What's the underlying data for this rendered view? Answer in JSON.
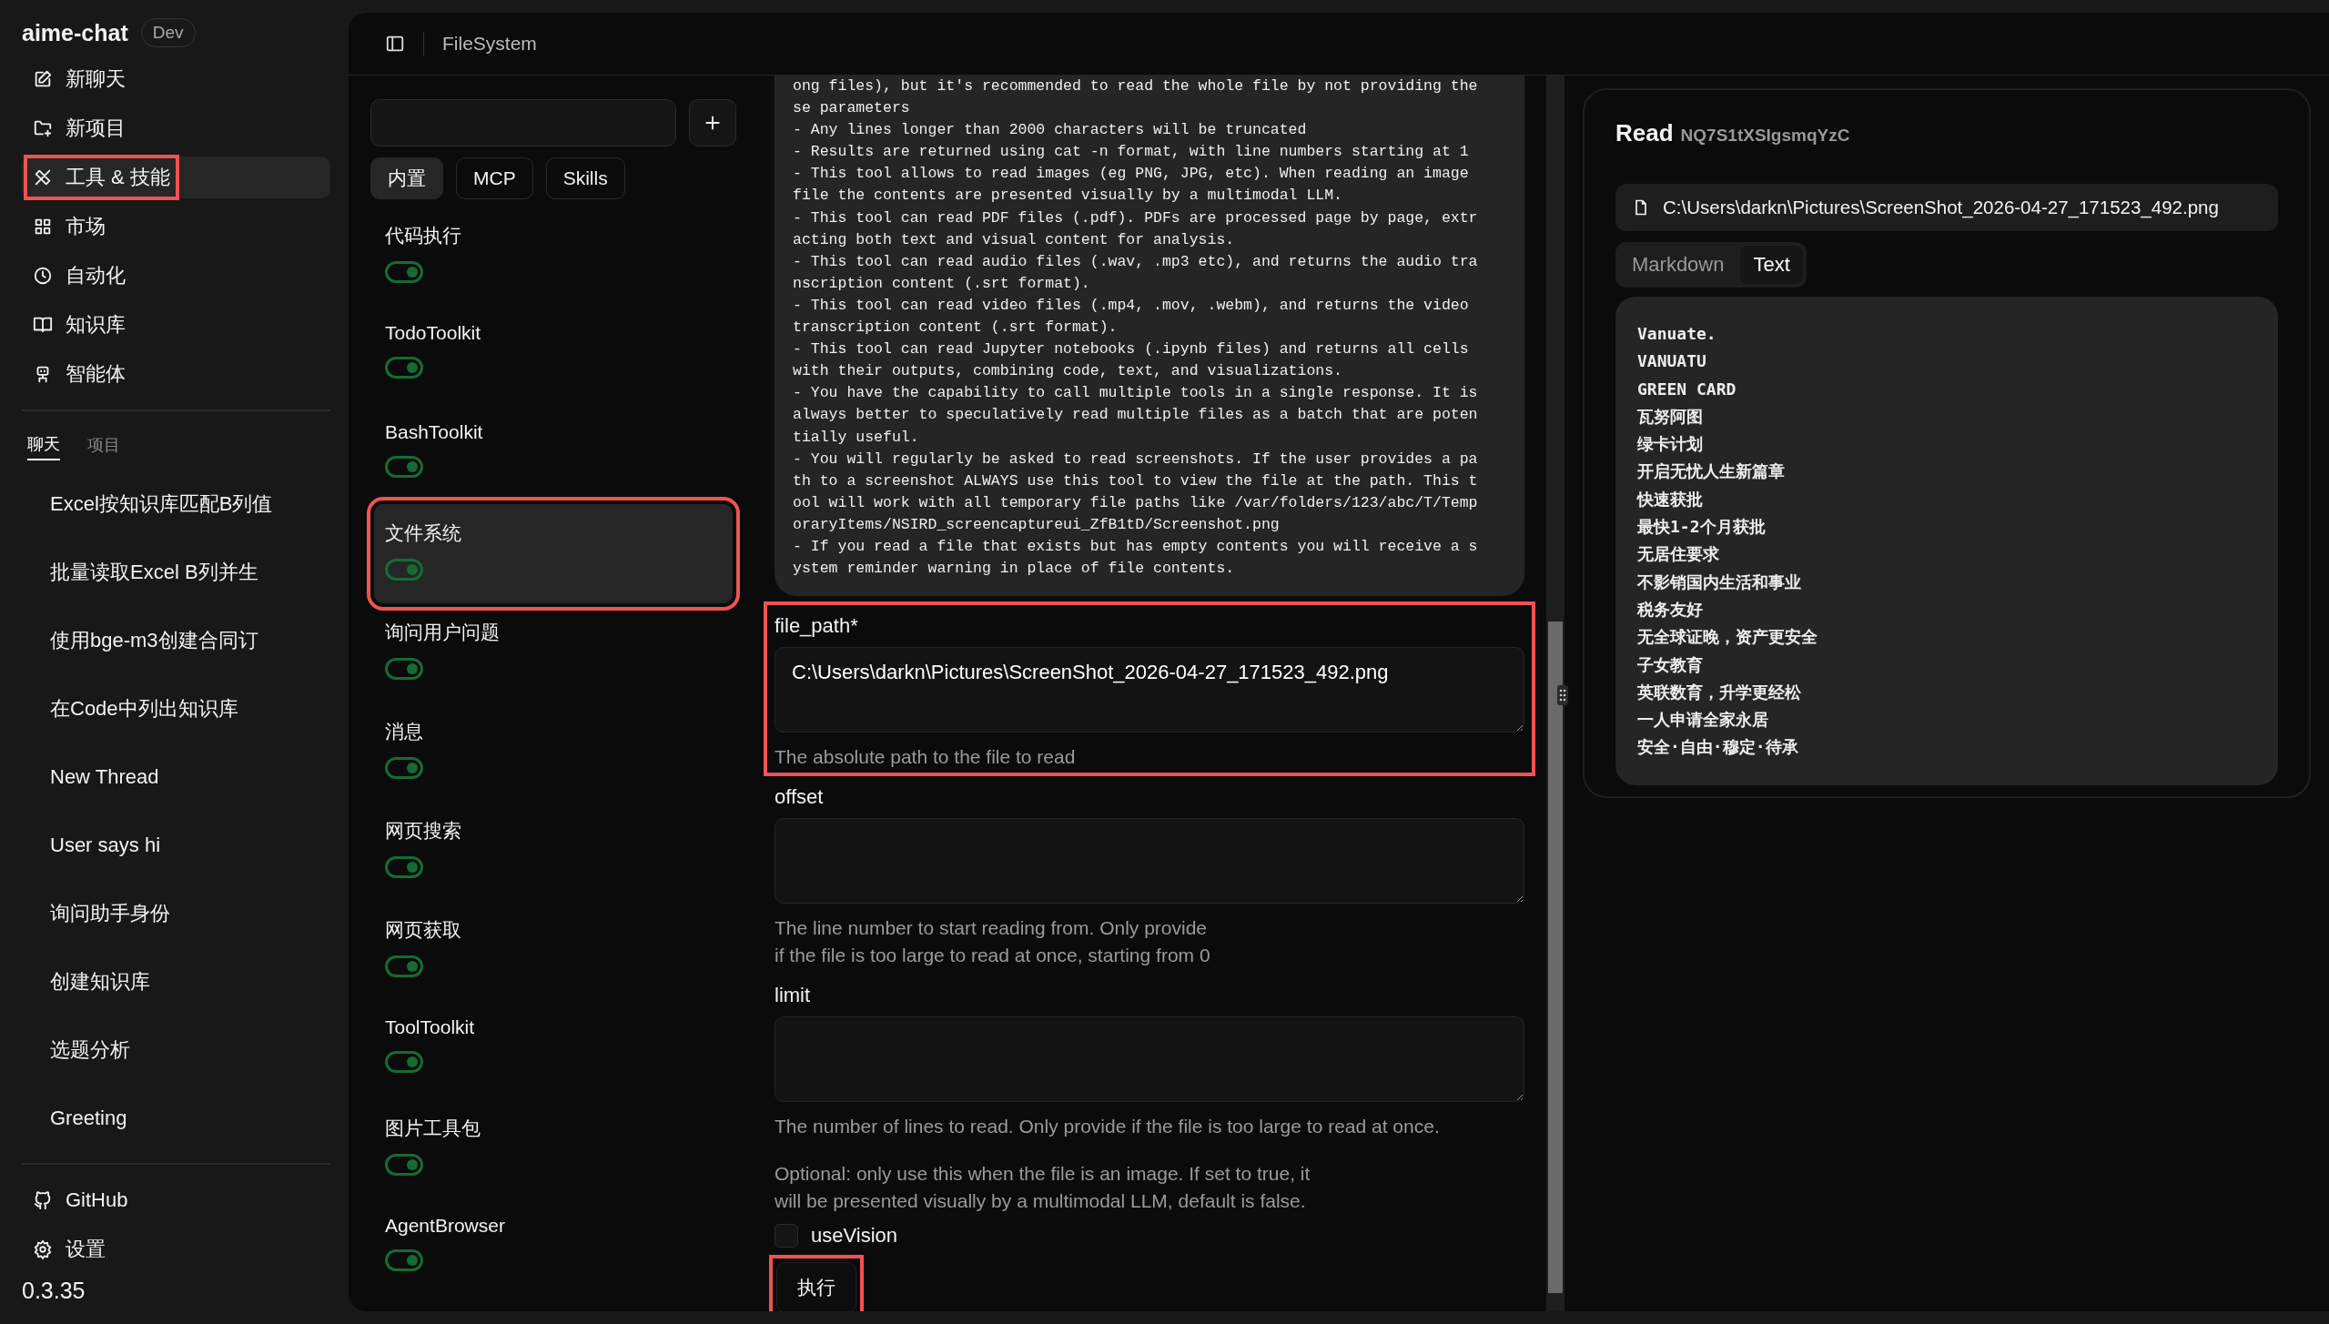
{
  "app": {
    "name": "aime-chat",
    "badge": "Dev",
    "version": "0.3.35"
  },
  "nav": [
    {
      "label": "新聊天",
      "kind": "edit",
      "selected": false,
      "highlighted": false
    },
    {
      "label": "新项目",
      "kind": "folder-plus",
      "selected": false,
      "highlighted": false
    },
    {
      "label": "工具 & 技能",
      "kind": "tools",
      "selected": true,
      "highlighted": true
    },
    {
      "label": "市场",
      "kind": "grid",
      "selected": false,
      "highlighted": false
    },
    {
      "label": "自动化",
      "kind": "clock",
      "selected": false,
      "highlighted": false
    },
    {
      "label": "知识库",
      "kind": "book",
      "selected": false,
      "highlighted": false
    },
    {
      "label": "智能体",
      "kind": "robot",
      "selected": false,
      "highlighted": false
    }
  ],
  "history_tabs": [
    {
      "label": "聊天",
      "selected": true
    },
    {
      "label": "项目",
      "selected": false
    }
  ],
  "chats": [
    "Excel按知识库匹配B列值",
    "批量读取Excel B列并生",
    "使用bge-m3创建合同订",
    "在Code中列出知识库",
    "New Thread",
    "User says hi",
    "询问助手身份",
    "创建知识库",
    "选题分析",
    "Greeting"
  ],
  "footer_links": [
    {
      "label": "GitHub",
      "kind": "github"
    },
    {
      "label": "设置",
      "kind": "settings"
    }
  ],
  "header": {
    "title": "FileSystem"
  },
  "tool_tabs": [
    {
      "label": "内置",
      "selected": true
    },
    {
      "label": "MCP",
      "selected": false
    },
    {
      "label": "Skills",
      "selected": false
    }
  ],
  "tools": [
    {
      "name": "代码执行",
      "on": true,
      "selected": false,
      "highlighted": false
    },
    {
      "name": "TodoToolkit",
      "on": true,
      "selected": false,
      "highlighted": false
    },
    {
      "name": "BashToolkit",
      "on": true,
      "selected": false,
      "highlighted": false
    },
    {
      "name": "文件系统",
      "on": true,
      "selected": true,
      "highlighted": true
    },
    {
      "name": "询问用户问题",
      "on": true,
      "selected": false,
      "highlighted": false
    },
    {
      "name": "消息",
      "on": true,
      "selected": false,
      "highlighted": false
    },
    {
      "name": "网页搜索",
      "on": true,
      "selected": false,
      "highlighted": false
    },
    {
      "name": "网页获取",
      "on": true,
      "selected": false,
      "highlighted": false
    },
    {
      "name": "ToolToolkit",
      "on": true,
      "selected": false,
      "highlighted": false
    },
    {
      "name": "图片工具包",
      "on": true,
      "selected": false,
      "highlighted": false
    },
    {
      "name": "AgentBrowser",
      "on": true,
      "selected": false,
      "highlighted": false
    }
  ],
  "description_lines": [
    "ong files), but it's recommended to read the whole file by not providing the",
    "se parameters",
    "- Any lines longer than 2000 characters will be truncated",
    "- Results are returned using cat -n format, with line numbers starting at 1",
    "- This tool allows to read images (eg PNG, JPG, etc). When reading an image",
    "file the contents are presented visually by a multimodal LLM.",
    "- This tool can read PDF files (.pdf). PDFs are processed page by page, extr",
    "acting both text and visual content for analysis.",
    "- This tool can read audio files (.wav, .mp3 etc), and returns the audio tra",
    "nscription content (.srt format).",
    "- This tool can read video files (.mp4, .mov, .webm), and returns the video",
    "transcription content (.srt format).",
    "- This tool can read Jupyter notebooks (.ipynb files) and returns all cells",
    "with their outputs, combining code, text, and visualizations.",
    "- You have the capability to call multiple tools in a single response. It is",
    "always better to speculatively read multiple files as a batch that are poten",
    "tially useful.",
    "- You will regularly be asked to read screenshots. If the user provides a pa",
    "th to a screenshot ALWAYS use this tool to view the file at the path. This t",
    "ool will work with all temporary file paths like /var/folders/123/abc/T/Temp",
    "oraryItems/NSIRD_screencaptureui_ZfB1tD/Screenshot.png",
    "- If you read a file that exists but has empty contents you will receive a s",
    "ystem reminder warning in place of file contents."
  ],
  "form": [
    {
      "kind": "textarea",
      "label": "file_path*",
      "value": "C:\\Users\\darkn\\Pictures\\ScreenShot_2026-04-27_171523_492.png",
      "hint_lines": [
        "The absolute path to the file to read"
      ],
      "highlighted": true
    },
    {
      "kind": "textarea",
      "label": "offset",
      "hint_lines": [
        "The line number to start reading from. Only provide",
        "if the file is too large to read at once, starting from 0"
      ],
      "highlighted": false
    },
    {
      "kind": "textarea",
      "label": "limit",
      "hint_lines": [
        "The number of lines to read. Only provide if the file is too large to read at once."
      ],
      "highlighted": false
    },
    {
      "kind": "checkbox",
      "label": "useVision",
      "hint_lines": [
        "Optional: only use this when the file is an image. If set to true, it",
        "will be presented visually by a multimodal LLM, default is false."
      ],
      "checked": false
    }
  ],
  "run_button": {
    "label": "执行",
    "highlighted": true
  },
  "result": {
    "title": "Read",
    "id": "NQ7S1tXSIgsmqYzC",
    "path": "C:\\Users\\darkn\\Pictures\\ScreenShot_2026-04-27_171523_492.png",
    "view_tabs": [
      {
        "label": "Markdown",
        "selected": false
      },
      {
        "label": "Text",
        "selected": true
      }
    ],
    "lines": [
      "Vanuate.",
      "VANUATU",
      "GREEN CARD",
      "瓦努阿图",
      "绿卡计划",
      "开启无忧人生新篇章",
      "快速获批",
      "最快1-2个月获批",
      "无居住要求",
      "不影销国内生活和事业",
      "税务友好",
      "无全球证晚，资产更安全",
      "子女教育",
      "英联数育，升学更经松",
      "一人申请全家永居",
      "安全·自由·穆定·待承"
    ]
  }
}
